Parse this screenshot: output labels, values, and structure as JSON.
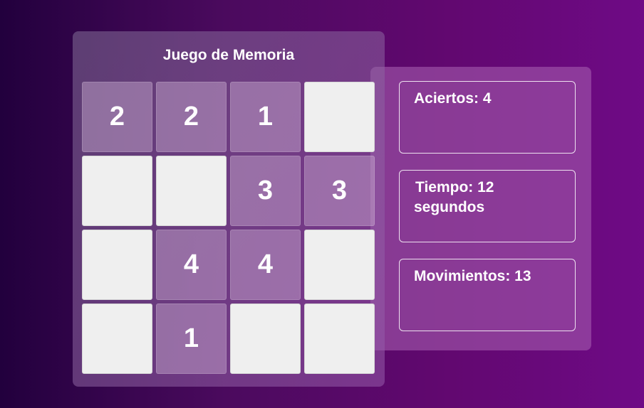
{
  "game": {
    "title": "Juego de Memoria",
    "cards": [
      {
        "value": "2",
        "state": "revealed"
      },
      {
        "value": "2",
        "state": "revealed"
      },
      {
        "value": "1",
        "state": "revealed"
      },
      {
        "value": "",
        "state": "hidden"
      },
      {
        "value": "",
        "state": "hidden"
      },
      {
        "value": "",
        "state": "hidden"
      },
      {
        "value": "3",
        "state": "revealed"
      },
      {
        "value": "3",
        "state": "revealed"
      },
      {
        "value": "",
        "state": "hidden"
      },
      {
        "value": "4",
        "state": "revealed"
      },
      {
        "value": "4",
        "state": "revealed"
      },
      {
        "value": "",
        "state": "hidden"
      },
      {
        "value": "",
        "state": "hidden"
      },
      {
        "value": "1",
        "state": "revealed"
      },
      {
        "value": "",
        "state": "hidden"
      },
      {
        "value": "",
        "state": "hidden"
      }
    ]
  },
  "stats": {
    "hits": "Aciertos: 4",
    "time_line1": "Tiempo: 12",
    "time_line2": "segundos",
    "moves": "Movimientos: 13"
  },
  "colors": {
    "hidden_card": "#efefef",
    "background_start": "#22003d",
    "background_end": "#6f0a86"
  }
}
